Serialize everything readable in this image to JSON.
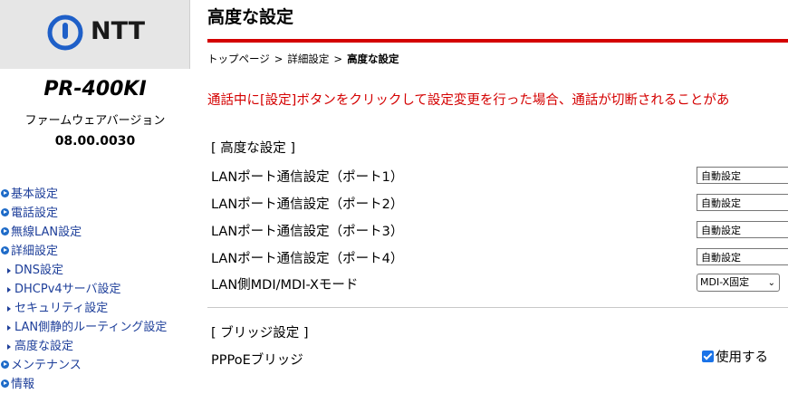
{
  "sidebar": {
    "logo_text": "NTT",
    "model": "PR-400KI",
    "firmware_label": "ファームウェアバージョン",
    "firmware_version": "08.00.0030",
    "menu": [
      {
        "label": "基本設定",
        "level": "top"
      },
      {
        "label": "電話設定",
        "level": "top"
      },
      {
        "label": "無線LAN設定",
        "level": "top"
      },
      {
        "label": "詳細設定",
        "level": "top"
      },
      {
        "label": "DNS設定",
        "level": "sub"
      },
      {
        "label": "DHCPv4サーバ設定",
        "level": "sub"
      },
      {
        "label": "セキュリティ設定",
        "level": "sub"
      },
      {
        "label": "LAN側静的ルーティング設定",
        "level": "sub"
      },
      {
        "label": "高度な設定",
        "level": "sub"
      },
      {
        "label": "メンテナンス",
        "level": "top"
      },
      {
        "label": "情報",
        "level": "top"
      }
    ]
  },
  "main": {
    "title": "高度な設定",
    "breadcrumb": [
      "トップページ",
      "詳細設定",
      "高度な設定"
    ],
    "breadcrumb_sep": ">",
    "warning": "通話中に[設定]ボタンをクリックして設定変更を行った場合、通話が切断されることがあ",
    "advanced_section": {
      "title": "[ 高度な設定 ]",
      "rows": [
        {
          "label": "LANポート通信設定（ポート1）",
          "value": "自動設定"
        },
        {
          "label": "LANポート通信設定（ポート2）",
          "value": "自動設定"
        },
        {
          "label": "LANポート通信設定（ポート3）",
          "value": "自動設定"
        },
        {
          "label": "LANポート通信設定（ポート4）",
          "value": "自動設定"
        },
        {
          "label": "LAN側MDI/MDI-Xモード",
          "value": "MDI-X固定"
        }
      ]
    },
    "bridge_section": {
      "title": "[ ブリッジ設定 ]",
      "pppoe_label": "PPPoEブリッジ",
      "pppoe_checkbox_label": "使用する",
      "pppoe_checked": true
    }
  },
  "colors": {
    "accent_red": "#d40000",
    "link_blue": "#1e3f9a",
    "logo_bg": "#e6e6e6"
  }
}
